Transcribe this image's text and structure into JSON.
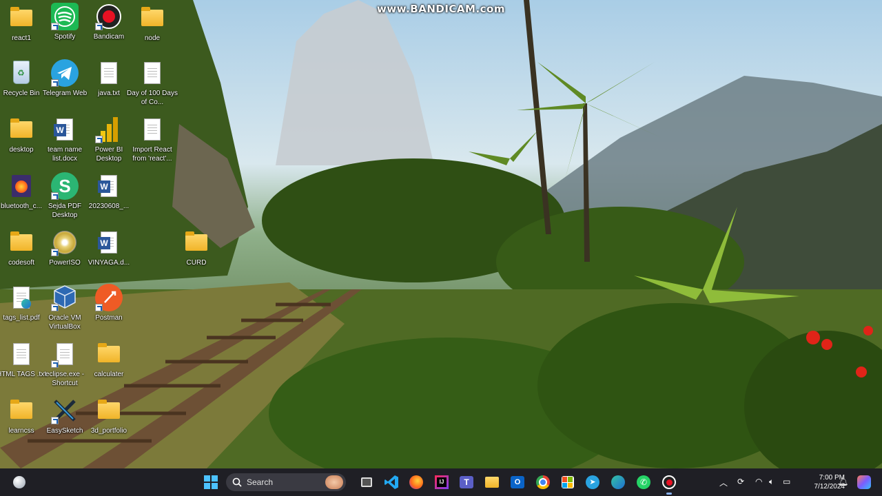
{
  "watermark": "www.BANDICAM.com",
  "desktop_icons": [
    {
      "label": "react1",
      "icon": "folder-icon"
    },
    {
      "label": "Spotify",
      "icon": "spotify-icon"
    },
    {
      "label": "Bandicam",
      "icon": "bandicam-icon"
    },
    {
      "label": "node",
      "icon": "folder-icon"
    },
    {
      "label": "Recycle Bin",
      "icon": "recycle-bin-icon"
    },
    {
      "label": "Telegram Web",
      "icon": "telegram-icon"
    },
    {
      "label": "java.txt",
      "icon": "text-file-icon"
    },
    {
      "label": "Day of 100 Days of Co...",
      "icon": "text-file-icon"
    },
    {
      "label": "desktop",
      "icon": "folder-icon"
    },
    {
      "label": "team name list.docx",
      "icon": "word-document-icon"
    },
    {
      "label": "Power BI Desktop",
      "icon": "power-bi-icon"
    },
    {
      "label": "Import React from 'react'...",
      "icon": "text-file-icon"
    },
    {
      "label": "bluetooth_c...",
      "icon": "firefox-icon"
    },
    {
      "label": "Sejda PDF Desktop",
      "icon": "sejda-icon"
    },
    {
      "label": "20230608_...",
      "icon": "word-document-icon"
    },
    {
      "label": "codesoft",
      "icon": "folder-icon"
    },
    {
      "label": "PowerISO",
      "icon": "poweriso-icon"
    },
    {
      "label": "VINYAGA.d...",
      "icon": "word-document-icon"
    },
    {
      "label": "CURD",
      "icon": "folder-icon"
    },
    {
      "label": "tags_list.pdf",
      "icon": "edge-pdf-icon"
    },
    {
      "label": "Oracle VM VirtualBox",
      "icon": "virtualbox-icon"
    },
    {
      "label": "Postman",
      "icon": "postman-icon"
    },
    {
      "label": "HTML TAGS .txt",
      "icon": "text-file-icon"
    },
    {
      "label": "eclipse.exe - Shortcut",
      "icon": "file-icon"
    },
    {
      "label": "calculater",
      "icon": "folder-icon"
    },
    {
      "label": "learncss",
      "icon": "folder-icon"
    },
    {
      "label": "EasySketch",
      "icon": "easysketch-icon"
    },
    {
      "label": "3d_portfolio",
      "icon": "folder-icon"
    }
  ],
  "taskbar": {
    "search_label": "Search",
    "apps": [
      "widgets-icon",
      "start-icon",
      "search-icon",
      "task-view-icon",
      "vscode-icon",
      "firefox-icon",
      "intellij-icon",
      "teams-icon",
      "file-explorer-icon",
      "outlook-icon",
      "chrome-icon",
      "store-icon",
      "telegram-icon",
      "edge-icon",
      "whatsapp-icon",
      "bandicam-icon"
    ],
    "time": "7:00 PM",
    "date": "7/12/2024"
  },
  "colors": {
    "taskbar": "#1f1f25",
    "accent": "#0078d4"
  }
}
